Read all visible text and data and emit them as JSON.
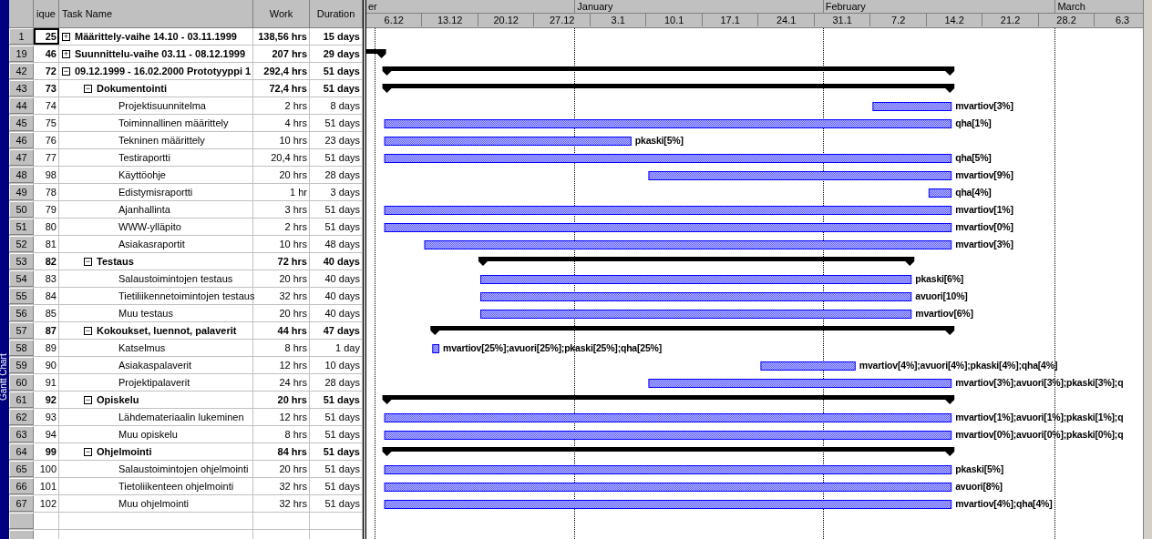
{
  "sidebar": {
    "label": "Gantt Chart"
  },
  "table": {
    "columns": [
      "ique",
      "Task Name",
      "Work",
      "Duration"
    ],
    "rows": [
      {
        "row": "1",
        "id": "25",
        "name": "Määrittely-vaihe 14.10 - 03.11.1999",
        "work": "138,56 hrs",
        "duration": "15 days",
        "kind": "summary",
        "toggle": "+",
        "active": true
      },
      {
        "row": "19",
        "id": "46",
        "name": "Suunnittelu-vaihe 03.11 - 08.12.1999",
        "work": "207 hrs",
        "duration": "29 days",
        "kind": "summary",
        "toggle": "+",
        "active": false
      },
      {
        "row": "42",
        "id": "72",
        "name": "09.12.1999 - 16.02.2000 Prototyyppi 1",
        "work": "292,4 hrs",
        "duration": "51 days",
        "kind": "summary",
        "toggle": "−",
        "active": false,
        "children": [
          {
            "row": "43",
            "id": "73",
            "name": "Dokumentointi",
            "work": "72,4 hrs",
            "duration": "51 days",
            "kind": "summary",
            "toggle": "−",
            "active": false,
            "children": [
              {
                "row": "44",
                "id": "74",
                "name": "Projektisuunnitelma",
                "work": "2 hrs",
                "duration": "8 days",
                "kind": "task",
                "active": false,
                "resources": "mvartiov[3%]"
              },
              {
                "row": "45",
                "id": "75",
                "name": "Toiminnallinen määrittely",
                "work": "4 hrs",
                "duration": "51 days",
                "kind": "task",
                "active": false,
                "resources": "qha[1%]"
              },
              {
                "row": "46",
                "id": "76",
                "name": "Tekninen määrittely",
                "work": "10 hrs",
                "duration": "23 days",
                "kind": "task",
                "active": false,
                "resources": "pkaski[5%]"
              },
              {
                "row": "47",
                "id": "77",
                "name": "Testiraportti",
                "work": "20,4 hrs",
                "duration": "51 days",
                "kind": "task",
                "active": false,
                "resources": "qha[5%]"
              },
              {
                "row": "48",
                "id": "98",
                "name": "Käyttöohje",
                "work": "20 hrs",
                "duration": "28 days",
                "kind": "task",
                "active": false,
                "resources": "mvartiov[9%]"
              },
              {
                "row": "49",
                "id": "78",
                "name": "Edistymisraportti",
                "work": "1 hr",
                "duration": "3 days",
                "kind": "task",
                "active": false,
                "resources": "qha[4%]"
              },
              {
                "row": "50",
                "id": "79",
                "name": "Ajanhallinta",
                "work": "3 hrs",
                "duration": "51 days",
                "kind": "task",
                "active": false,
                "resources": "mvartiov[1%]"
              },
              {
                "row": "51",
                "id": "80",
                "name": "WWW-ylläpito",
                "work": "2 hrs",
                "duration": "51 days",
                "kind": "task",
                "active": false,
                "resources": "mvartiov[0%]"
              },
              {
                "row": "52",
                "id": "81",
                "name": "Asiakasraportit",
                "work": "10 hrs",
                "duration": "48 days",
                "kind": "task",
                "active": false,
                "resources": "mvartiov[3%]"
              }
            ]
          },
          {
            "row": "53",
            "id": "82",
            "name": "Testaus",
            "work": "72 hrs",
            "duration": "40 days",
            "kind": "summary",
            "toggle": "−",
            "active": false,
            "children": [
              {
                "row": "54",
                "id": "83",
                "name": "Salaustoimintojen testaus",
                "work": "20 hrs",
                "duration": "40 days",
                "kind": "task",
                "active": false,
                "resources": "pkaski[6%]"
              },
              {
                "row": "55",
                "id": "84",
                "name": "Tietiliikennetoimintojen testaus",
                "work": "32 hrs",
                "duration": "40 days",
                "kind": "task",
                "active": false,
                "resources": "avuori[10%]"
              },
              {
                "row": "56",
                "id": "85",
                "name": "Muu testaus",
                "work": "20 hrs",
                "duration": "40 days",
                "kind": "task",
                "active": false,
                "resources": "mvartiov[6%]"
              }
            ]
          },
          {
            "row": "57",
            "id": "87",
            "name": "Kokoukset, luennot, palaverit",
            "work": "44 hrs",
            "duration": "47 days",
            "kind": "summary",
            "toggle": "−",
            "active": false,
            "children": [
              {
                "row": "58",
                "id": "89",
                "name": "Katselmus",
                "work": "8 hrs",
                "duration": "1 day",
                "kind": "task",
                "active": false,
                "resources": "mvartiov[25%];avuori[25%];pkaski[25%];qha[25%]"
              },
              {
                "row": "59",
                "id": "90",
                "name": "Asiakaspalaverit",
                "work": "12 hrs",
                "duration": "10 days",
                "kind": "task",
                "active": false,
                "resources": "mvartiov[4%];avuori[4%];pkaski[4%];qha[4%]"
              },
              {
                "row": "60",
                "id": "91",
                "name": "Projektipalaverit",
                "work": "24 hrs",
                "duration": "28 days",
                "kind": "task",
                "active": false,
                "resources": "mvartiov[3%];avuori[3%];pkaski[3%];q"
              }
            ]
          },
          {
            "row": "61",
            "id": "92",
            "name": "Opiskelu",
            "work": "20 hrs",
            "duration": "51 days",
            "kind": "summary",
            "toggle": "−",
            "active": false,
            "children": [
              {
                "row": "62",
                "id": "93",
                "name": "Lähdemateriaalin lukeminen",
                "work": "12 hrs",
                "duration": "51 days",
                "kind": "task",
                "active": false,
                "resources": "mvartiov[1%];avuori[1%];pkaski[1%];q"
              },
              {
                "row": "63",
                "id": "94",
                "name": "Muu opiskelu",
                "work": "8 hrs",
                "duration": "51 days",
                "kind": "task",
                "active": false,
                "resources": "mvartiov[0%];avuori[0%];pkaski[0%];q"
              }
            ]
          },
          {
            "row": "64",
            "id": "99",
            "name": "Ohjelmointi",
            "work": "84 hrs",
            "duration": "51 days",
            "kind": "summary",
            "toggle": "−",
            "active": false,
            "children": [
              {
                "row": "65",
                "id": "100",
                "name": "Salaustoimintojen ohjelmointi",
                "work": "20 hrs",
                "duration": "51 days",
                "kind": "task",
                "active": false,
                "resources": "pkaski[5%]"
              },
              {
                "row": "66",
                "id": "101",
                "name": "Tietoliikenteen ohjelmointi",
                "work": "32 hrs",
                "duration": "51 days",
                "kind": "task",
                "active": false,
                "resources": "avuori[8%]"
              },
              {
                "row": "67",
                "id": "102",
                "name": "Muu ohjelmointi",
                "work": "32 hrs",
                "duration": "51 days",
                "kind": "task",
                "active": false,
                "resources": "mvartiov[4%];qha[4%]"
              }
            ]
          }
        ]
      }
    ]
  },
  "timescale": {
    "months": [
      "er",
      "January",
      "February",
      "March"
    ],
    "weeks": [
      "6.12",
      "13.12",
      "20.12",
      "27.12",
      "3.1",
      "10.1",
      "17.1",
      "24.1",
      "31.1",
      "7.2",
      "14.2",
      "21.2",
      "28.2",
      "6.3"
    ]
  }
}
